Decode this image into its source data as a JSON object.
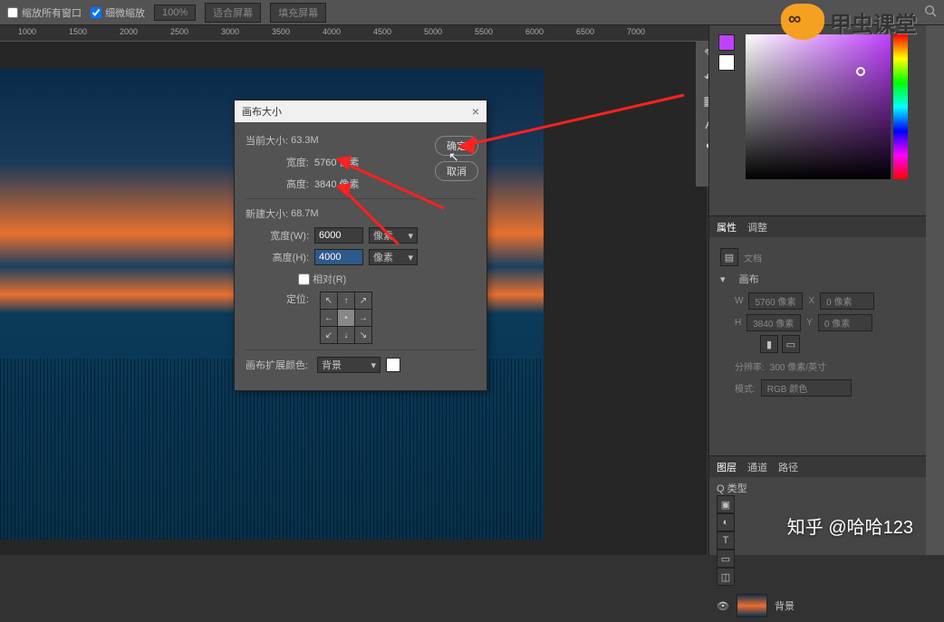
{
  "topbar": {
    "zoom_all_windows": "缩放所有窗口",
    "fine_zoom": "细微缩放",
    "zoom_pct": "100%",
    "fit_screen": "适合屏幕",
    "fill_screen": "填充屏幕"
  },
  "ruler": [
    "1000",
    "1500",
    "2000",
    "2500",
    "3000",
    "3500",
    "4000",
    "4500",
    "5000",
    "5500",
    "6000",
    "6500",
    "7000"
  ],
  "dialog": {
    "title": "画布大小",
    "current_size_label": "当前大小:",
    "current_size": "63.3M",
    "width_label": "宽度:",
    "cur_width": "5760 像素",
    "height_label": "高度:",
    "cur_height": "3840 像素",
    "new_size_label": "新建大小:",
    "new_size": "68.7M",
    "width_w": "宽度(W):",
    "new_width": "6000",
    "height_h": "高度(H):",
    "new_height": "4000",
    "unit": "像素",
    "relative": "相对(R)",
    "anchor_label": "定位:",
    "extension_label": "画布扩展颜色:",
    "extension_value": "背景",
    "ok": "确定",
    "cancel": "取消"
  },
  "panels": {
    "props_tab": "属性",
    "adjust_tab": "调整",
    "doc_label": "文档",
    "canvas_group": "画布",
    "w_abbr": "W",
    "w_val": "5760 像素",
    "x_abbr": "X",
    "x_val": "0 像素",
    "h_abbr": "H",
    "h_val": "3840 像素",
    "y_abbr": "Y",
    "y_val": "0 像素",
    "resolution_label": "分辨率:",
    "resolution_val": "300 像素/英寸",
    "mode_label": "模式:",
    "mode_val": "RGB 颜色"
  },
  "layers": {
    "tab_layers": "图层",
    "tab_channels": "通道",
    "tab_paths": "路径",
    "kind": "Q 类型",
    "bg_layer": "背景"
  },
  "watermark1": "甲虫课堂",
  "watermark2": "知乎 @哈哈123"
}
